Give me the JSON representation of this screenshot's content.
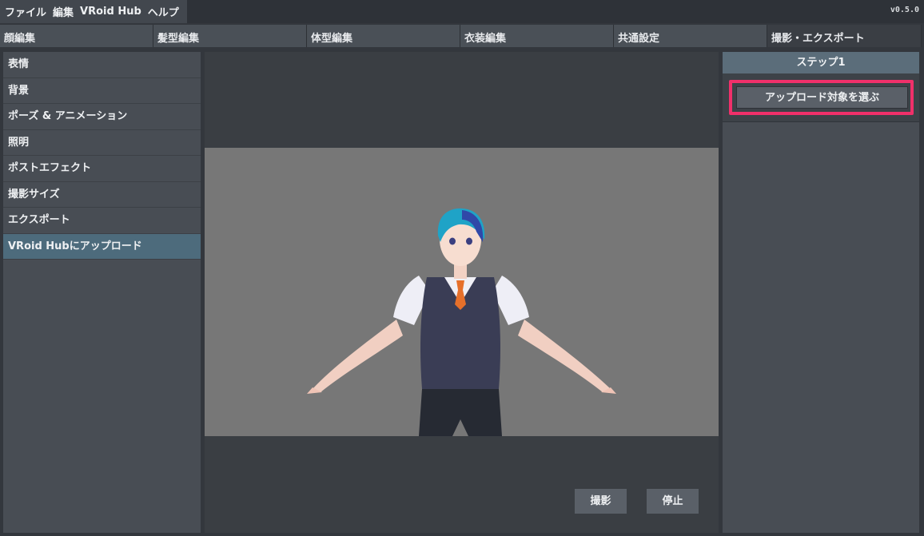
{
  "menubar": {
    "items": [
      "ファイル",
      "編集",
      "VRoid Hub",
      "ヘルプ"
    ],
    "version": "v0.5.0"
  },
  "tabs": [
    {
      "label": "顔編集"
    },
    {
      "label": "髪型編集"
    },
    {
      "label": "体型編集"
    },
    {
      "label": "衣装編集"
    },
    {
      "label": "共通設定"
    },
    {
      "label": "撮影・エクスポート",
      "active": true
    }
  ],
  "sidebar": {
    "items": [
      {
        "label": "表情"
      },
      {
        "label": "背景"
      },
      {
        "label": "ポーズ & アニメーション"
      },
      {
        "label": "照明"
      },
      {
        "label": "ポストエフェクト"
      },
      {
        "label": "撮影サイズ"
      },
      {
        "label": "エクスポート"
      },
      {
        "label": "VRoid Hubにアップロード",
        "selected": true
      }
    ]
  },
  "viewport": {
    "controls": {
      "capture": "撮影",
      "stop": "停止"
    }
  },
  "step_panel": {
    "title": "ステップ1",
    "select_button": "アップロード対象を選ぶ"
  },
  "colors": {
    "highlight": "#f0306a",
    "selected_item": "#4d6b7c",
    "viewport_bg": "#777777"
  }
}
